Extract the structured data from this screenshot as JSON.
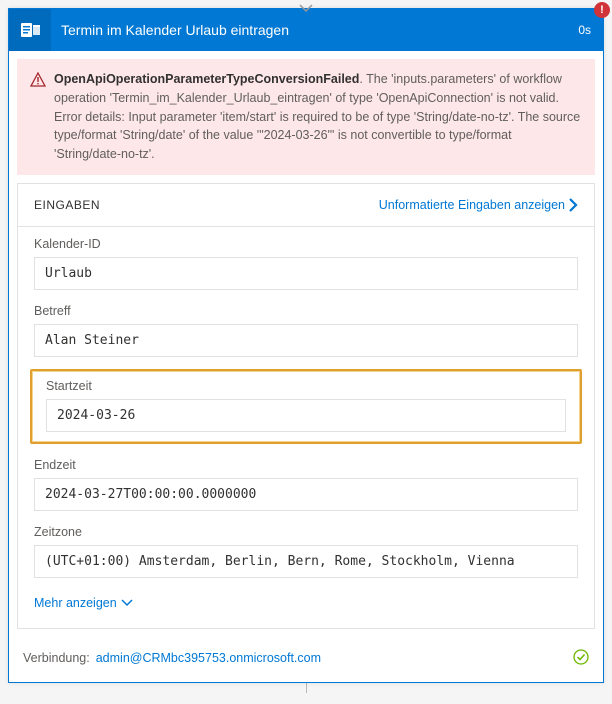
{
  "header": {
    "title": "Termin im Kalender Urlaub eintragen",
    "duration": "0s"
  },
  "error": {
    "title": "OpenApiOperationParameterTypeConversionFailed",
    "message": ". The 'inputs.parameters' of workflow operation 'Termin_im_Kalender_Urlaub_eintragen' of type 'OpenApiConnection' is not valid. Error details: Input parameter 'item/start' is required to be of type 'String/date-no-tz'. The source type/format 'String/date' of the value '\"2024-03-26\"' is not convertible to type/format 'String/date-no-tz'."
  },
  "inputs": {
    "panel_title": "EINGABEN",
    "raw_link": "Unformatierte Eingaben anzeigen",
    "fields": {
      "calendar_id": {
        "label": "Kalender-ID",
        "value": "Urlaub"
      },
      "subject": {
        "label": "Betreff",
        "value": "Alan Steiner"
      },
      "start": {
        "label": "Startzeit",
        "value": "2024-03-26"
      },
      "end": {
        "label": "Endzeit",
        "value": "2024-03-27T00:00:00.0000000"
      },
      "timezone": {
        "label": "Zeitzone",
        "value": "(UTC+01:00) Amsterdam, Berlin, Bern, Rome, Stockholm, Vienna"
      }
    },
    "more_label": "Mehr anzeigen"
  },
  "footer": {
    "label": "Verbindung:",
    "account": "admin@CRMbc395753.onmicrosoft.com"
  }
}
